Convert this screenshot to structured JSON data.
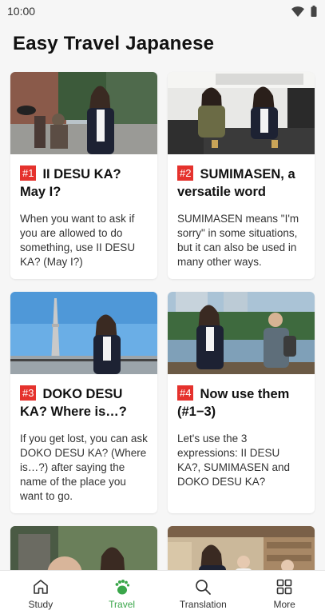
{
  "status": {
    "time": "10:00",
    "wifi_icon": "wifi-icon",
    "battery_icon": "battery-icon"
  },
  "app": {
    "title": "Easy Travel Japanese"
  },
  "cards": [
    {
      "number": "#1",
      "title": "II DESU KA? May I?",
      "description": "When you want to ask if you are allowed to do something, use II DESU KA? (May I?)"
    },
    {
      "number": "#2",
      "title": "SUMIMASEN, a versatile word",
      "description": "SUMIMASEN means \"I'm sorry\" in some situations, but it can also be used in many other ways."
    },
    {
      "number": "#3",
      "title": "DOKO DESU KA? Where is…?",
      "description": "If you get lost, you can ask DOKO DESU KA? (Where is…?) after saying the name of the place you want to go."
    },
    {
      "number": "#4",
      "title": "Now use them (#1−3)",
      "description": "Let's use the 3 expressions: II DESU KA?, SUMIMASEN and DOKO DESU KA?"
    }
  ],
  "nav": {
    "items": [
      {
        "label": "Study",
        "icon": "home-icon"
      },
      {
        "label": "Travel",
        "icon": "footprints-icon",
        "active": true
      },
      {
        "label": "Translation",
        "icon": "search-icon"
      },
      {
        "label": "More",
        "icon": "grid-icon"
      }
    ]
  },
  "colors": {
    "accent": "#3aa64a",
    "badge": "#e5322d"
  }
}
